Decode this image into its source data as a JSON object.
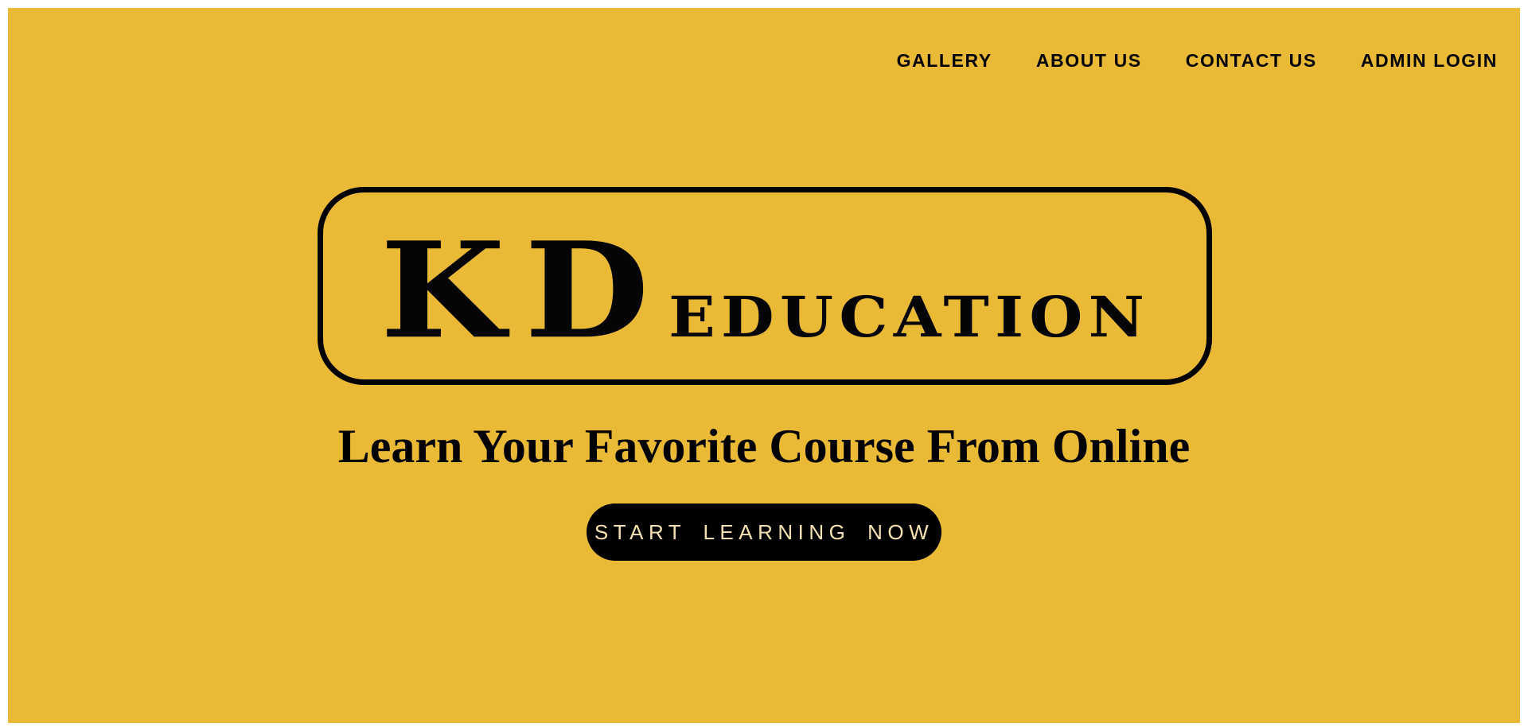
{
  "nav": {
    "items": [
      {
        "label": "GALLERY"
      },
      {
        "label": "ABOUT US"
      },
      {
        "label": "CONTACT US"
      },
      {
        "label": "ADMIN LOGIN"
      }
    ]
  },
  "logo": {
    "initials": "KD",
    "text": "education"
  },
  "hero": {
    "tagline": "Learn Your Favorite Course From Online",
    "cta_label": "START LEARNING NOW"
  },
  "colors": {
    "background": "#eaba36",
    "text": "#000000",
    "button_bg": "#000000",
    "button_text": "#f6e2b0"
  }
}
